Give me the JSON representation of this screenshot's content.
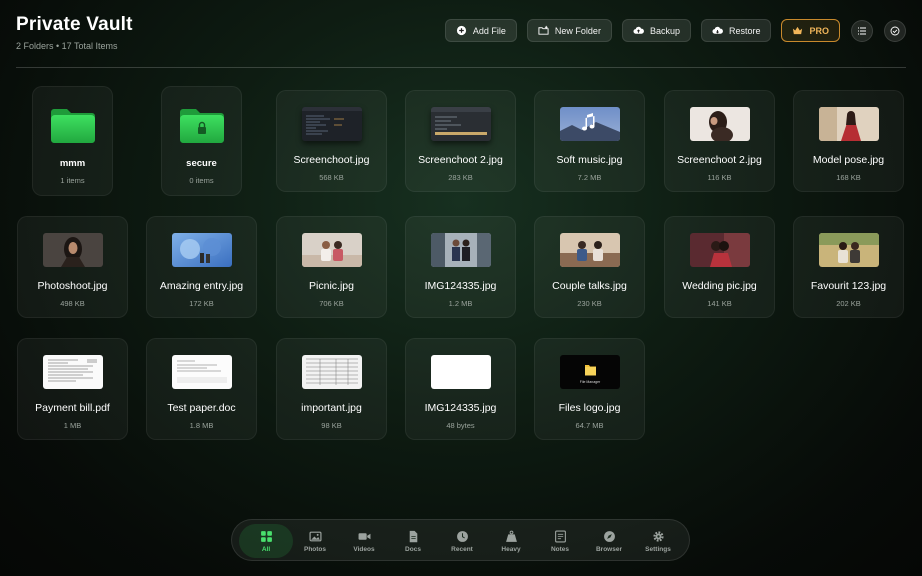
{
  "header": {
    "title": "Private Vault",
    "subtitle": "2 Folders • 17 Total Items"
  },
  "toolbar": {
    "add_file": "Add File",
    "new_folder": "New Folder",
    "backup": "Backup",
    "restore": "Restore",
    "pro": "PRO"
  },
  "colors": {
    "accent_green": "#2fc84f",
    "pro_gold": "#f0b55a"
  },
  "folders": [
    {
      "name": "mmm",
      "meta": "1 items",
      "icon": "folder-icon"
    },
    {
      "name": "secure",
      "meta": "0 items",
      "icon": "locked-folder-icon"
    }
  ],
  "files": [
    {
      "name": "Screenchoot.jpg",
      "meta": "568 KB"
    },
    {
      "name": "Screenchoot 2.jpg",
      "meta": "283 KB"
    },
    {
      "name": "Soft music.jpg",
      "meta": "7.2 MB"
    },
    {
      "name": "Screenchoot 2.jpg",
      "meta": "116 KB"
    },
    {
      "name": "Model pose.jpg",
      "meta": "168 KB"
    },
    {
      "name": "Photoshoot.jpg",
      "meta": "498 KB"
    },
    {
      "name": "Amazing entry.jpg",
      "meta": "172 KB"
    },
    {
      "name": "Picnic.jpg",
      "meta": "706 KB"
    },
    {
      "name": "IMG124335.jpg",
      "meta": "1.2 MB"
    },
    {
      "name": "Couple talks.jpg",
      "meta": "230 KB"
    },
    {
      "name": "Wedding pic.jpg",
      "meta": "141 KB"
    },
    {
      "name": "Favourit 123.jpg",
      "meta": "202 KB"
    },
    {
      "name": "Payment bill.pdf",
      "meta": "1 MB"
    },
    {
      "name": "Test paper.doc",
      "meta": "1.8 MB"
    },
    {
      "name": "important.jpg",
      "meta": "98 KB"
    },
    {
      "name": "IMG124335.jpg",
      "meta": "48 bytes"
    },
    {
      "name": "Files logo.jpg",
      "meta": "64.7 MB",
      "thumb_caption": "File Manager"
    }
  ],
  "nav": {
    "items": [
      {
        "label": "All",
        "icon": "grid-icon",
        "active": true
      },
      {
        "label": "Photos",
        "icon": "photo-icon"
      },
      {
        "label": "Videos",
        "icon": "video-icon"
      },
      {
        "label": "Docs",
        "icon": "document-icon"
      },
      {
        "label": "Recent",
        "icon": "clock-icon"
      },
      {
        "label": "Heavy",
        "icon": "weight-icon"
      },
      {
        "label": "Notes",
        "icon": "notes-icon"
      },
      {
        "label": "Browser",
        "icon": "compass-icon"
      },
      {
        "label": "Settings",
        "icon": "gear-icon"
      }
    ]
  }
}
